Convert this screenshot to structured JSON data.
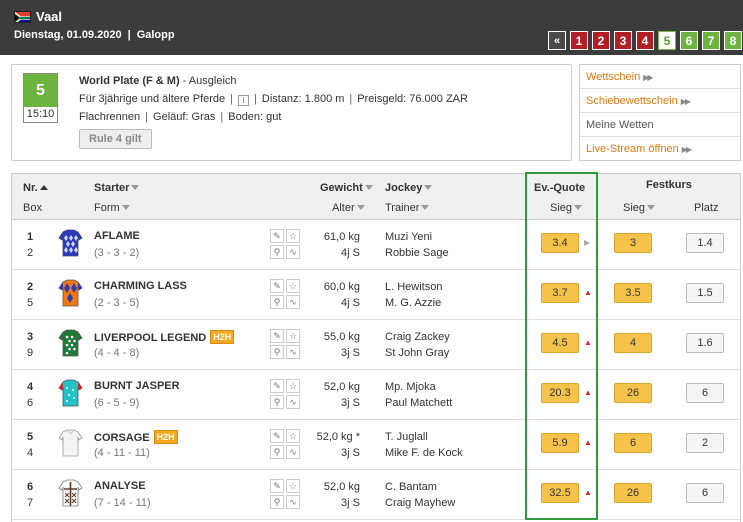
{
  "header": {
    "track": "Vaal",
    "date": "Dienstag, 01.09.2020",
    "separator": "|",
    "type": "Galopp",
    "race_nav": [
      {
        "label": "«",
        "state": "prev"
      },
      {
        "label": "1",
        "state": "done"
      },
      {
        "label": "2",
        "state": "done"
      },
      {
        "label": "3",
        "state": "done"
      },
      {
        "label": "4",
        "state": "done"
      },
      {
        "label": "5",
        "state": "current"
      },
      {
        "label": "6",
        "state": "next"
      },
      {
        "label": "7",
        "state": "next"
      },
      {
        "label": "8",
        "state": "next"
      }
    ]
  },
  "race": {
    "number": "5",
    "time": "15:10",
    "title": "World Plate (F & M)",
    "category": " - Ausgleich",
    "eligibility": "Für 3jährige und ältere Pferde",
    "info_icon": "i",
    "distance": "Distanz: 1.800 m",
    "prize": "Preisgeld: 76.000 ZAR",
    "surface": "Flachrennen",
    "ground": "Geläuf: Gras",
    "soil": "Boden: gut",
    "rule4": "Rule 4 gilt",
    "sep": "|"
  },
  "links": [
    {
      "label": "Wettschein",
      "arrows": "▶▶",
      "style": "orange"
    },
    {
      "label": "Schiebewettschein",
      "arrows": "▶▶",
      "style": "orange"
    },
    {
      "label": "Meine Wetten",
      "arrows": "",
      "style": "plain"
    },
    {
      "label": "Live-Stream öffnen",
      "arrows": "▶▶",
      "style": "orange"
    }
  ],
  "table": {
    "headers": {
      "nr": "Nr.",
      "box": "Box",
      "starter": "Starter",
      "form": "Form",
      "gewicht": "Gewicht",
      "alter": "Alter",
      "jockey": "Jockey",
      "trainer": "Trainer",
      "evquote": "Ev.-Quote",
      "sieg": "Sieg",
      "festkurs": "Festkurs",
      "fk_sieg": "Sieg",
      "platz": "Platz"
    },
    "rows": [
      {
        "nr": "1",
        "box": "2",
        "name": "AFLAME",
        "h2h": "",
        "form": "(3 - 3 - 2)",
        "weight": "61,0 kg",
        "age": "4j S",
        "jockey": "Muzi  Yeni",
        "trainer": "Robbie Sage",
        "ev": "3.4",
        "trend": "side",
        "fk_sieg": "3",
        "platz": "1.4",
        "jersey": "blue-diamonds"
      },
      {
        "nr": "2",
        "box": "5",
        "name": "CHARMING LASS",
        "h2h": "",
        "form": "(2 - 3 - 5)",
        "weight": "60,0 kg",
        "age": "4j S",
        "jockey": "L.  Hewitson",
        "trainer": "M. G. Azzie",
        "ev": "3.7",
        "trend": "up",
        "fk_sieg": "3.5",
        "platz": "1.5",
        "jersey": "orange-blue"
      },
      {
        "nr": "3",
        "box": "9",
        "name": "LIVERPOOL LEGEND",
        "h2h": "H2H",
        "form": "(4 - 4 - 8)",
        "weight": "55,0 kg",
        "age": "3j S",
        "jockey": "Craig  Zackey",
        "trainer": "St John Gray",
        "ev": "4.5",
        "trend": "up",
        "fk_sieg": "4",
        "platz": "1.6",
        "jersey": "green-dots"
      },
      {
        "nr": "4",
        "box": "6",
        "name": "BURNT JASPER",
        "h2h": "",
        "form": "(6 - 5 - 9)",
        "weight": "52,0 kg",
        "age": "3j S",
        "jockey": "Mp.  Mjoka",
        "trainer": "Paul Matchett",
        "ev": "20.3",
        "trend": "up",
        "fk_sieg": "26",
        "platz": "6",
        "jersey": "teal-red"
      },
      {
        "nr": "5",
        "box": "4",
        "name": "CORSAGE",
        "h2h": "H2H",
        "form": "(4 - 11 - 11)",
        "weight": "52,0 kg *",
        "age": "3j S",
        "jockey": "T.  Juglall",
        "trainer": "Mike F. de Kock",
        "ev": "5.9",
        "trend": "up",
        "fk_sieg": "6",
        "platz": "2",
        "jersey": "white"
      },
      {
        "nr": "6",
        "box": "7",
        "name": "ANALYSE",
        "h2h": "",
        "form": "(7 - 14 - 11)",
        "weight": "52,0 kg",
        "age": "3j S",
        "jockey": "C.  Bantam",
        "trainer": "Craig Mayhew",
        "ev": "32.5",
        "trend": "up",
        "fk_sieg": "26",
        "platz": "6",
        "jersey": "white-crosses"
      }
    ]
  },
  "colors": {
    "header_bg": "#3c3c3c",
    "race_done": "#b21e23",
    "race_next": "#6cb33f",
    "odds_bg": "#f6c34a",
    "link_orange": "#e07b14",
    "highlight_green": "#2e9a3a"
  }
}
